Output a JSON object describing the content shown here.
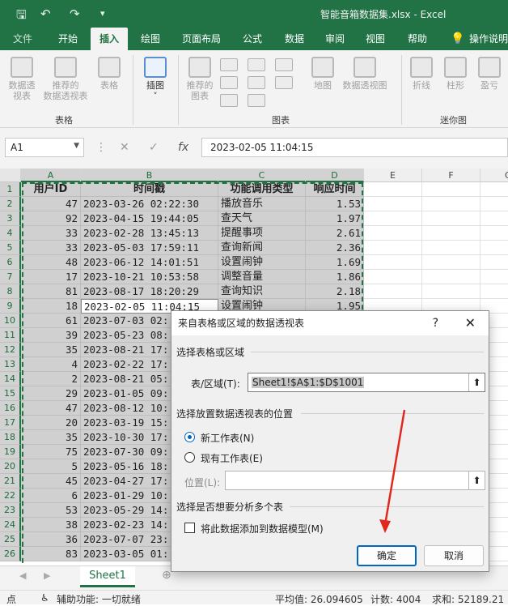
{
  "window": {
    "title": "智能音箱数据集.xlsx  -  Excel"
  },
  "tabs": [
    "文件",
    "开始",
    "插入",
    "绘图",
    "页面布局",
    "公式",
    "数据",
    "审阅",
    "视图",
    "帮助",
    "操作说明"
  ],
  "ribbon": {
    "tables_group": {
      "label": "表格",
      "pivot_table": [
        "数据透",
        "视表"
      ],
      "recommended_pivot": [
        "推荐的",
        "数据透视表"
      ],
      "table": "表格"
    },
    "illustrations": {
      "label": "插图"
    },
    "charts_group": {
      "label": "图表",
      "recommended_charts": [
        "推荐的",
        "图表"
      ],
      "map": "地图",
      "pivot_chart": "数据透视图"
    },
    "sparklines_group": {
      "label": "迷你图",
      "line": "折线",
      "column": "柱形",
      "winloss": "盈亏"
    }
  },
  "formula_bar": {
    "name_box": "A1",
    "fx": "fx",
    "formula": "2023-02-05 11:04:15"
  },
  "columns": [
    "A",
    "B",
    "C",
    "D",
    "E",
    "F",
    "G"
  ],
  "headers": [
    "用户ID",
    "时间戳",
    "功能调用类型",
    "响应时间"
  ],
  "rows": [
    [
      "47",
      "2023-03-26 02:22:30",
      "播放音乐",
      "1.53"
    ],
    [
      "92",
      "2023-04-15 19:44:05",
      "查天气",
      "1.97"
    ],
    [
      "33",
      "2023-02-28 13:45:13",
      "提醒事项",
      "2.61"
    ],
    [
      "33",
      "2023-05-03 17:59:11",
      "查询新闻",
      "2.36"
    ],
    [
      "48",
      "2023-06-12 14:01:51",
      "设置闹钟",
      "1.69"
    ],
    [
      "17",
      "2023-10-21 10:53:58",
      "调整音量",
      "1.86"
    ],
    [
      "81",
      "2023-08-17 18:20:29",
      "查询知识",
      "2.18"
    ],
    [
      "18",
      "2023-02-05 11:04:15",
      "设置闹钟",
      "1.95"
    ],
    [
      "61",
      "2023-07-03 02:",
      "",
      ""
    ],
    [
      "39",
      "2023-05-23 08:",
      "",
      ""
    ],
    [
      "35",
      "2023-08-21 17:",
      "",
      ""
    ],
    [
      "4",
      "2023-02-22 17:",
      "",
      ""
    ],
    [
      "2",
      "2023-08-21 05:",
      "",
      ""
    ],
    [
      "29",
      "2023-01-05 09:",
      "",
      ""
    ],
    [
      "47",
      "2023-08-12 10:",
      "",
      ""
    ],
    [
      "20",
      "2023-03-19 15:",
      "",
      ""
    ],
    [
      "35",
      "2023-10-30 17:",
      "",
      ""
    ],
    [
      "75",
      "2023-07-30 09:",
      "",
      ""
    ],
    [
      "5",
      "2023-05-16 18:",
      "",
      ""
    ],
    [
      "45",
      "2023-04-27 17:",
      "",
      ""
    ],
    [
      "6",
      "2023-01-29 10:",
      "",
      ""
    ],
    [
      "53",
      "2023-05-29 14:",
      "",
      ""
    ],
    [
      "38",
      "2023-02-23 14:",
      "",
      ""
    ],
    [
      "36",
      "2023-07-07 23:",
      "",
      ""
    ],
    [
      "83",
      "2023-03-05 01:",
      "",
      ""
    ]
  ],
  "sheet": {
    "name": "Sheet1"
  },
  "status": {
    "mode": "点",
    "accessibility": "辅助功能: 一切就绪",
    "average": "平均值: 26.094605",
    "count": "计数: 4004",
    "sum": "求和: 52189.21"
  },
  "dialog": {
    "title": "来自表格或区域的数据透视表",
    "help": "?",
    "close": "✕",
    "section1": "选择表格或区域",
    "range_label": "表/区域(T):",
    "range_value": "Sheet1!$A$1:$D$1001",
    "section2": "选择放置数据透视表的位置",
    "opt_new": "新工作表(N)",
    "opt_existing": "现有工作表(E)",
    "location_label": "位置(L):",
    "section3": "选择是否想要分析多个表",
    "datamodel": "将此数据添加到数据模型(M)",
    "ok": "确定",
    "cancel": "取消"
  },
  "colors": {
    "excel_green": "#217346",
    "accent_blue": "#0067c0",
    "arrow_red": "#e0281e"
  }
}
